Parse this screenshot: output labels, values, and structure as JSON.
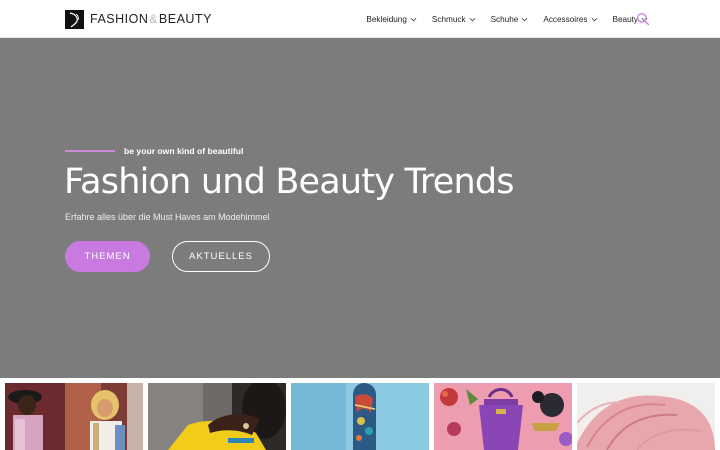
{
  "header": {
    "logo": {
      "part1": "FASHION",
      "amp": "&",
      "part2": "BEAUTY",
      "icon": "logo-mark-icon"
    },
    "nav": [
      {
        "label": "Bekleidung",
        "icon": "chevron-down-icon"
      },
      {
        "label": "Schmuck",
        "icon": "chevron-down-icon"
      },
      {
        "label": "Schuhe",
        "icon": "chevron-down-icon"
      },
      {
        "label": "Accessoires",
        "icon": "chevron-down-icon"
      },
      {
        "label": "Beauty",
        "icon": "chevron-down-icon"
      }
    ],
    "search_icon": "search-icon"
  },
  "hero": {
    "tagline": "be your own kind of beautiful",
    "title": "Fashion und Beauty Trends",
    "subtitle": "Erfahre alles über die Must Haves am Modehimmel",
    "primary_button": "THEMEN",
    "secondary_button": "AKTUELLES"
  },
  "thumbnails": [
    {
      "name": "thumb-street-fashion"
    },
    {
      "name": "thumb-yellow-portrait"
    },
    {
      "name": "thumb-boot-sky"
    },
    {
      "name": "thumb-purple-bag"
    },
    {
      "name": "thumb-pink-hair"
    }
  ],
  "colors": {
    "accent": "#c97ae1",
    "hero_bg": "#7c7c7c",
    "tagline_line": "#c98ad6",
    "text_dark": "#222222"
  }
}
